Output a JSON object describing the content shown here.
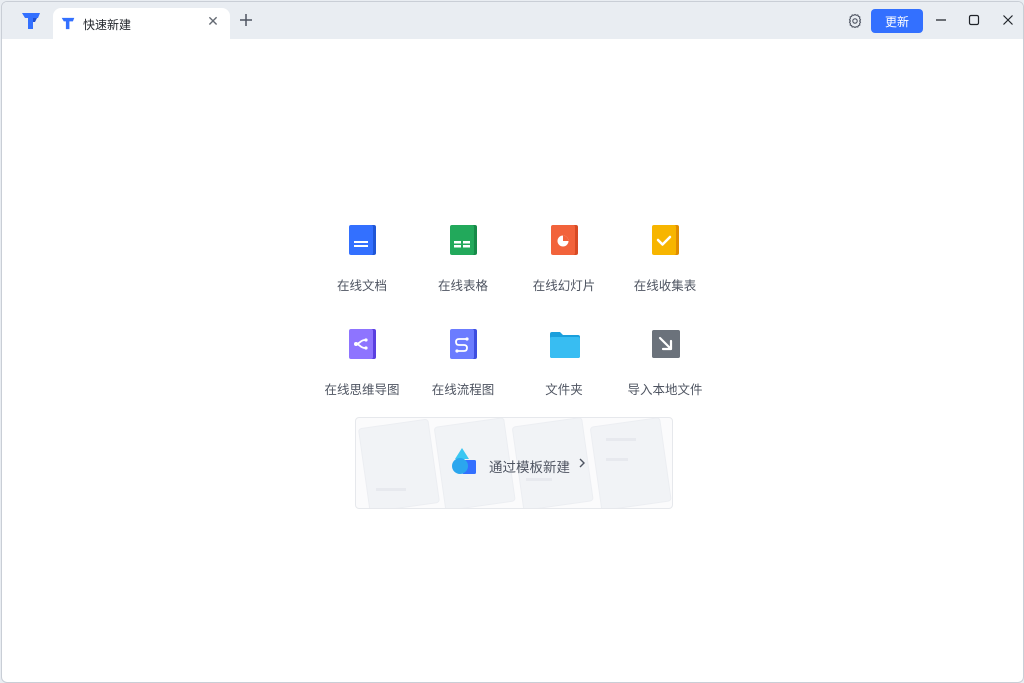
{
  "titlebar": {
    "tab_title": "快速新建",
    "update_button": "更新"
  },
  "create_items": [
    {
      "label": "在线文档",
      "icon": "doc-icon",
      "color": "#3370ff"
    },
    {
      "label": "在线表格",
      "icon": "sheet-icon",
      "color": "#22a95b"
    },
    {
      "label": "在线幻灯片",
      "icon": "slides-icon",
      "color": "#f2633b"
    },
    {
      "label": "在线收集表",
      "icon": "form-icon",
      "color": "#f7b500"
    },
    {
      "label": "在线思维导图",
      "icon": "mindmap-icon",
      "color": "#7b61ff"
    },
    {
      "label": "在线流程图",
      "icon": "flowchart-icon",
      "color": "#5b6cff"
    },
    {
      "label": "文件夹",
      "icon": "folder-icon",
      "color": "#2bb3ef"
    },
    {
      "label": "导入本地文件",
      "icon": "import-icon",
      "color": "#646a73"
    }
  ],
  "template": {
    "label": "通过模板新建"
  },
  "colors": {
    "accent": "#3370ff",
    "titlebar_bg": "#e9edf2"
  }
}
